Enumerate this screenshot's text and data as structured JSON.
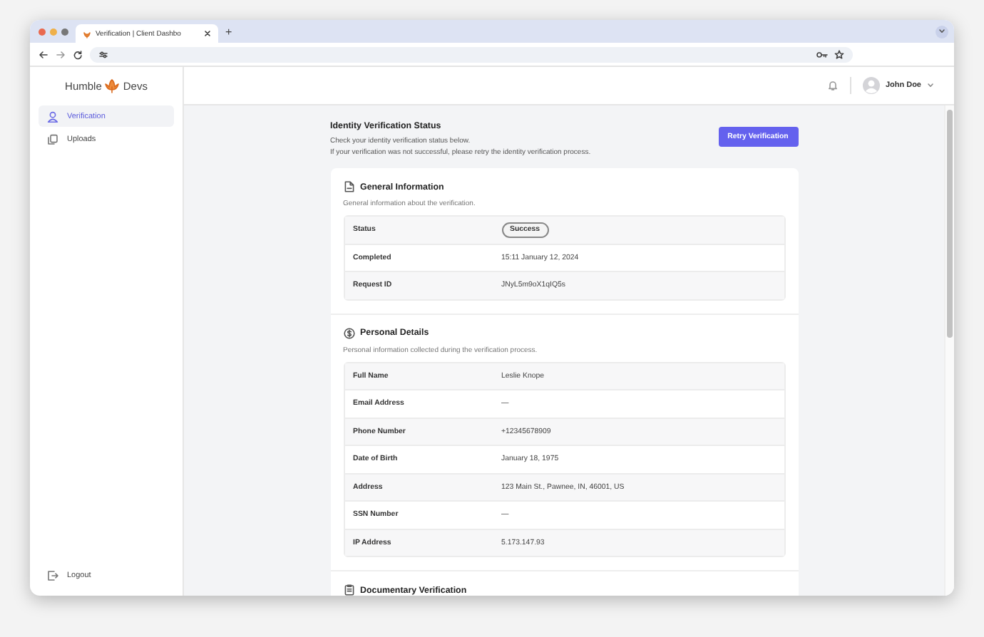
{
  "browser": {
    "tab_title": "Verification | Client Dashbo",
    "new_tab": "+"
  },
  "sidebar": {
    "logo": {
      "left": "Humble",
      "right": "Devs"
    },
    "items": [
      {
        "label": "Verification",
        "selected": true
      },
      {
        "label": "Uploads",
        "selected": false
      }
    ],
    "logout": "Logout"
  },
  "header": {
    "user": "John Doe"
  },
  "page": {
    "title": "Identity Verification Status",
    "description": [
      "Check your identity verification status below.",
      "If your verification was not successful, please retry the identity verification process."
    ],
    "button": "Retry Verification"
  },
  "sections": [
    {
      "title": "General Information",
      "description": "General information about the verification.",
      "rows": [
        {
          "label": "Status",
          "value": "Success",
          "kind": "badge"
        },
        {
          "label": "Completed",
          "value": "15:11 January 12, 2024",
          "kind": "text"
        },
        {
          "label": "Request ID",
          "value": "JNyL5m9oX1qIQ5s",
          "kind": "text"
        }
      ]
    },
    {
      "title": "Personal Details",
      "description": "Personal information collected during the verification process.",
      "rows": [
        {
          "label": "Full Name",
          "value": "Leslie Knope",
          "kind": "text"
        },
        {
          "label": "Email Address",
          "value": "—",
          "kind": "text"
        },
        {
          "label": "Phone Number",
          "value": "+12345678909",
          "kind": "text"
        },
        {
          "label": "Date of Birth",
          "value": "January 18, 1975",
          "kind": "text"
        },
        {
          "label": "Address",
          "value": "123 Main St., Pawnee, IN, 46001, US",
          "kind": "text"
        },
        {
          "label": "SSN Number",
          "value": "—",
          "kind": "text"
        },
        {
          "label": "IP Address",
          "value": "5.173.147.93",
          "kind": "text"
        }
      ]
    },
    {
      "title": "Documentary Verification"
    }
  ]
}
